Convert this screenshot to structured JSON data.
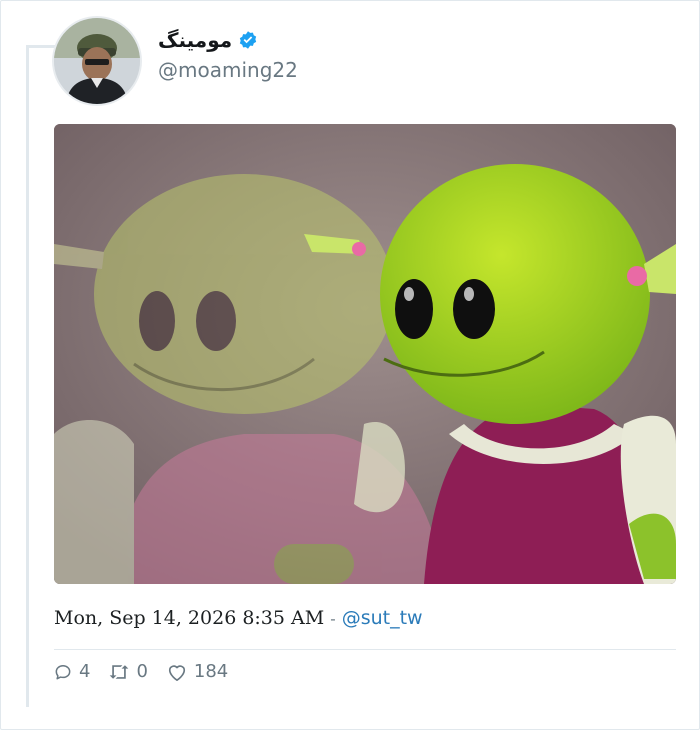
{
  "tweet": {
    "display_name": "مومینگ",
    "verified": true,
    "handle": "@moaming22",
    "media_alt": "",
    "datetime": "Mon, Sep 14, 2026 8:35 AM",
    "separator": "-",
    "via_handle": "@sut_tw",
    "stats": {
      "replies": "4",
      "retweets": "0",
      "likes": "184"
    }
  },
  "colors": {
    "link": "#2b7bb9",
    "muted": "#697882",
    "verified": "#1da1f2",
    "border": "#e1e8ed"
  },
  "icons": {
    "verified": "verified-badge-icon",
    "reply": "reply-icon",
    "retweet": "retweet-icon",
    "like": "heart-icon"
  }
}
